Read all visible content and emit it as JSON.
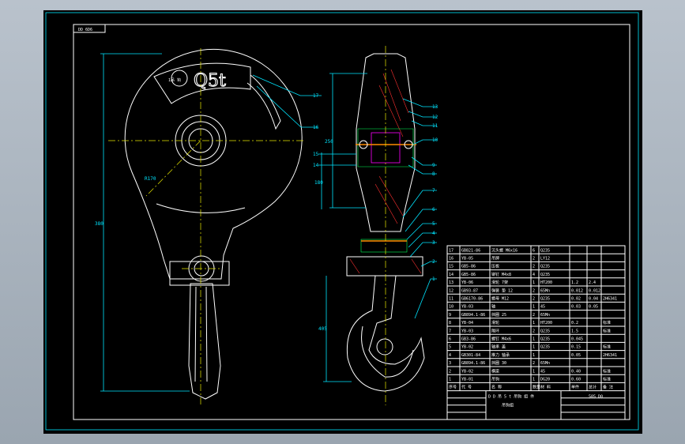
{
  "drawing": {
    "frame_tag": "DD 6D6",
    "load_marking": "Q5t",
    "nameplate_glyphs": "1吊 钩",
    "title_block": {
      "project": "D D 吊 5 t 吊钩 组 件",
      "sheet_name": "吊钩组",
      "code": "505 D0",
      "header_cells": [
        "序号",
        "代 号",
        "名 称",
        "数量",
        "材 料",
        "单件",
        "总计",
        "备 注"
      ]
    },
    "part_numbers": [
      "1",
      "2",
      "3",
      "4",
      "5",
      "6",
      "7",
      "8",
      "9",
      "10",
      "11",
      "12",
      "13",
      "14",
      "15",
      "16",
      "17"
    ],
    "dimensions": {
      "side_height": "380",
      "hook_radius": "R170",
      "front_upper": "250",
      "front_mid": "180",
      "front_lower": "405"
    },
    "bom_rows": [
      [
        "17",
        "GB821-86",
        "沉头螺 M6x16",
        "6",
        "Q235",
        "",
        "",
        ""
      ],
      [
        "16",
        "YB-05",
        "吊牌",
        "2",
        "LY12",
        "",
        "",
        ""
      ],
      [
        "15",
        "GB5-86",
        "压板",
        "2",
        "Q235",
        "",
        "",
        ""
      ],
      [
        "14",
        "GB5-86",
        "铆钉 M4x8",
        "4",
        "Q235",
        "",
        "",
        ""
      ],
      [
        "13",
        "YB-06",
        "滑轮 7架",
        "1",
        "HT200",
        "1.2",
        "2.4",
        ""
      ],
      [
        "12",
        "GB93-87",
        "弹簧 垫 12",
        "2",
        "65Mn",
        "0.012",
        "0.012",
        ""
      ],
      [
        "11",
        "GB6170-86",
        "螺母 M12",
        "2",
        "Q235",
        "0.02",
        "0.04",
        "2H6341"
      ],
      [
        "10",
        "YB-03",
        "轴",
        "1",
        "45",
        "0.03",
        "0.05",
        ""
      ],
      [
        "9",
        "GB894.1-86",
        "挡圈 25",
        "2",
        "65Mn",
        "",
        "",
        ""
      ],
      [
        "8",
        "YB-04",
        "滑轮",
        "1",
        "HT200",
        "0.2",
        "",
        "标准"
      ],
      [
        "7",
        "YB-03",
        "隔环",
        "2",
        "Q235",
        "1.5",
        "",
        "标准"
      ],
      [
        "6",
        "GB3-86",
        "螺钉 M4x6",
        "1",
        "Q235",
        "0.045",
        "",
        ""
      ],
      [
        "5",
        "YB-02",
        "轴承 盖",
        "1",
        "Q235",
        "0.15",
        "",
        "标准"
      ],
      [
        "4",
        "GB301-84",
        "推力 轴承",
        "1",
        "",
        "0.05",
        "",
        "2H6341"
      ],
      [
        "3",
        "GB894.1-86",
        "挡圈 30",
        "2",
        "65Mn",
        "",
        "",
        ""
      ],
      [
        "2",
        "YB-02",
        "横梁",
        "1",
        "45",
        "0.40",
        "",
        "标准"
      ],
      [
        "1",
        "YB-01",
        "吊钩",
        "1",
        "DG20",
        "0.60",
        "",
        "标准"
      ]
    ]
  }
}
